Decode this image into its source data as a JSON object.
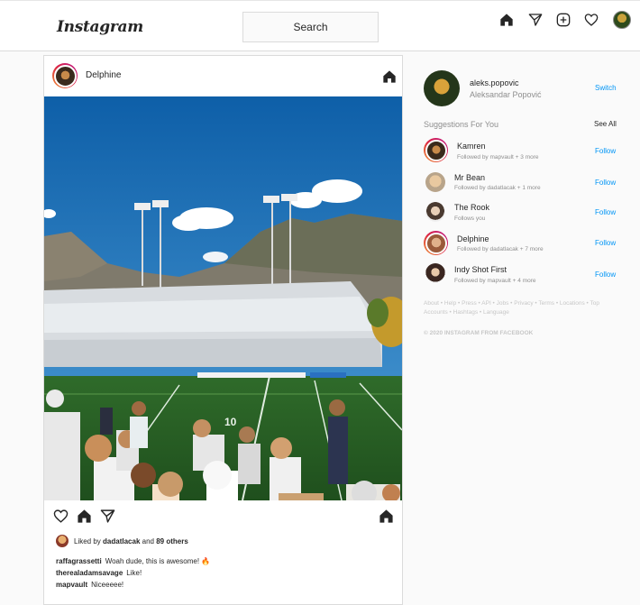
{
  "app": {
    "logo": "Instagram"
  },
  "header": {
    "search_label": "Search",
    "icons": [
      "home-icon",
      "direct-icon",
      "new-post-icon",
      "activity-icon",
      "profile-avatar"
    ]
  },
  "post": {
    "username": "Delphine",
    "liked_by_prefix": "Liked by",
    "liked_by_user": "dadatlacak",
    "liked_by_and": "and",
    "liked_by_others": "89 others",
    "comments": [
      {
        "user": "raffagrassetti",
        "text": "Woah dude, this is awesome! 🔥"
      },
      {
        "user": "therealadamsavage",
        "text": "Like!"
      },
      {
        "user": "mapvault",
        "text": "Niceeeee!"
      }
    ]
  },
  "sidebar": {
    "me": {
      "username": "aleks.popovic",
      "name": "Aleksandar Popović",
      "switch_label": "Switch"
    },
    "suggestions_title": "Suggestions For You",
    "see_all": "See All",
    "suggestions": [
      {
        "name": "Kamren",
        "subtitle": "Followed by mapvault + 3 more",
        "action": "Follow"
      },
      {
        "name": "Mr Bean",
        "subtitle": "Followed by dadatlacak + 1 more",
        "action": "Follow"
      },
      {
        "name": "The Rook",
        "subtitle": "Follows you",
        "action": "Follow"
      },
      {
        "name": "Delphine",
        "subtitle": "Followed by dadatlacak + 7 more",
        "action": "Follow"
      },
      {
        "name": "Indy Shot First",
        "subtitle": "Followed by mapvault + 4 more",
        "action": "Follow"
      }
    ],
    "footer_links": "About • Help • Press • API • Jobs • Privacy • Terms • Locations • Top Accounts • Hashtags • Language",
    "copyright": "© 2020 INSTAGRAM FROM FACEBOOK"
  },
  "colors": {
    "link_blue": "#0095f6",
    "border": "#dbdbdb",
    "muted": "#8e8e8e"
  }
}
